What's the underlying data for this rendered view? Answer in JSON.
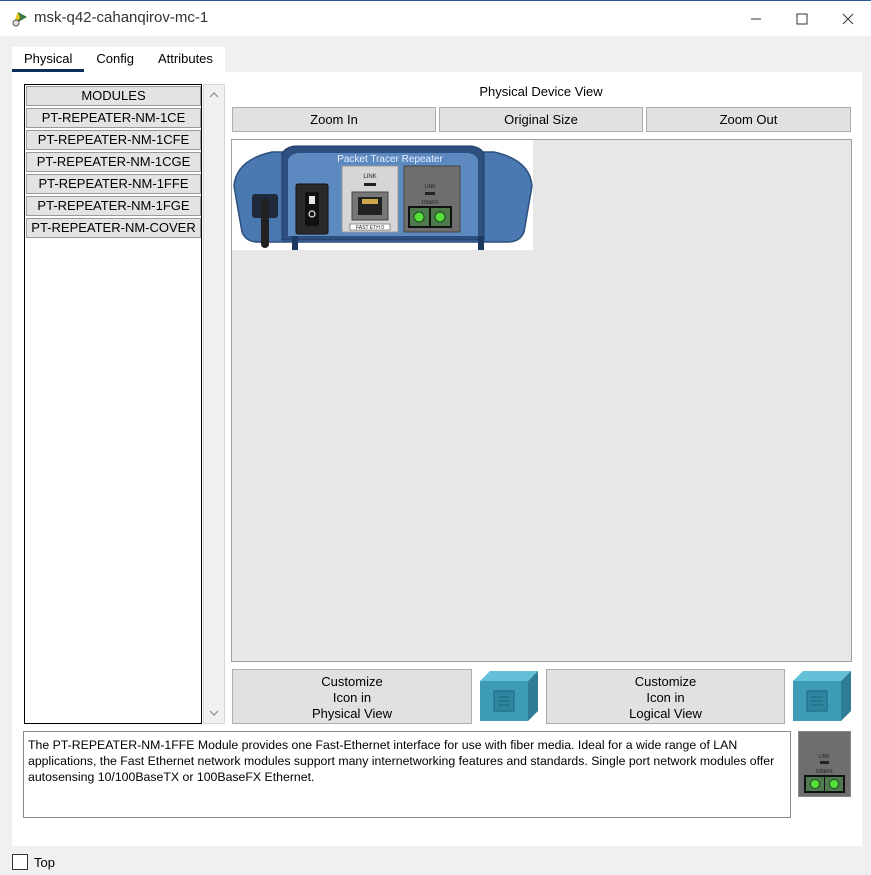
{
  "window": {
    "title": "msk-q42-cahanqirov-mc-1",
    "icons": {
      "app": "packet-tracer-app-icon",
      "minimize": "minimize-icon",
      "maximize": "maximize-icon",
      "close": "close-icon"
    }
  },
  "tabs": [
    {
      "label": "Physical",
      "active": true
    },
    {
      "label": "Config",
      "active": false
    },
    {
      "label": "Attributes",
      "active": false
    }
  ],
  "modules": {
    "header": "MODULES",
    "items": [
      "PT-REPEATER-NM-1CE",
      "PT-REPEATER-NM-1CFE",
      "PT-REPEATER-NM-1CGE",
      "PT-REPEATER-NM-1FFE",
      "PT-REPEATER-NM-1FGE",
      "PT-REPEATER-NM-COVER"
    ]
  },
  "physical_view": {
    "title": "Physical Device View",
    "zoom_in": "Zoom In",
    "original_size": "Original Size",
    "zoom_out": "Zoom Out",
    "device": {
      "name": "Packet Tracer Repeater",
      "port_labels": {
        "link": "LINK",
        "fast_eth": "FAST ETH 0",
        "fiber_link": "LINK",
        "fiber": "100bFX"
      }
    }
  },
  "customize": {
    "physical": [
      "Customize",
      "Icon in",
      "Physical View"
    ],
    "logical": [
      "Customize",
      "Icon in",
      "Logical View"
    ]
  },
  "description": "The PT-REPEATER-NM-1FFE Module provides one Fast-Ethernet interface for use with fiber media. Ideal for a wide range of LAN applications, the Fast Ethernet network modules support many internetworking features and standards. Single port network modules offer autosensing 10/100BaseTX or 100BaseFX Ethernet.",
  "thumbnail": {
    "link_label": "LINK",
    "fiber_label": "100bFX"
  },
  "footer": {
    "top_label": "Top",
    "top_checked": false
  },
  "colors": {
    "accent": "#0b2d59",
    "device_blue": "#4a78b0",
    "cube_teal": "#3e9bb5"
  }
}
